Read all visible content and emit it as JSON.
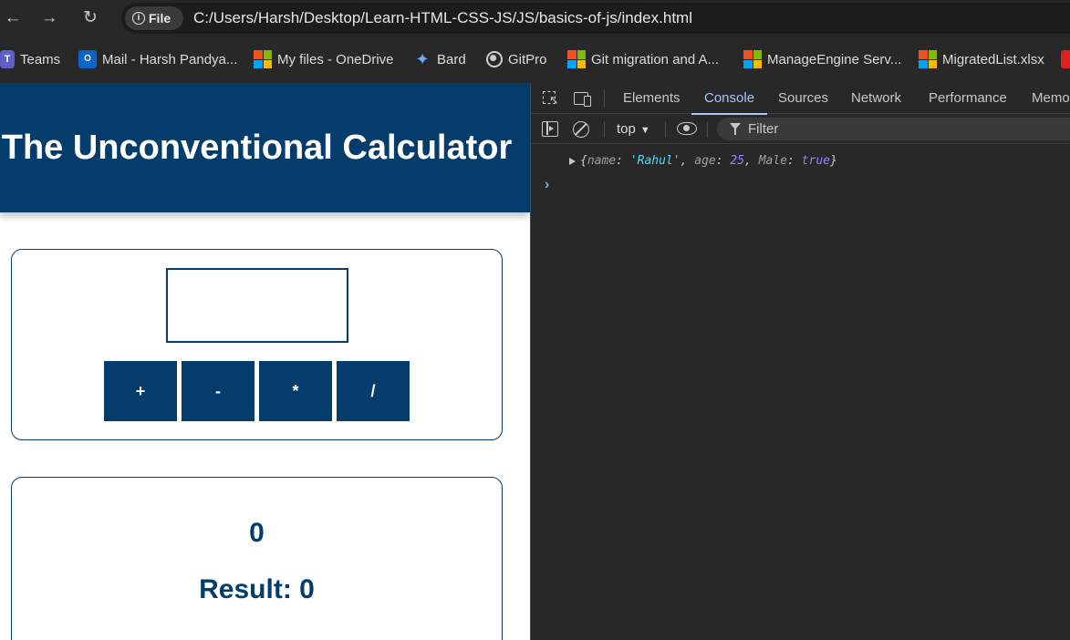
{
  "browser": {
    "file_chip": "File",
    "url": "C:/Users/Harsh/Desktop/Learn-HTML-CSS-JS/JS/basics-of-js/index.html"
  },
  "bookmarks": [
    {
      "label": "Teams"
    },
    {
      "label": "Mail - Harsh Pandya..."
    },
    {
      "label": "My files - OneDrive"
    },
    {
      "label": "Bard"
    },
    {
      "label": "GitPro"
    },
    {
      "label": "Git migration and A..."
    },
    {
      "label": "ManageEngine Serv..."
    },
    {
      "label": "MigratedList.xlsx"
    }
  ],
  "page": {
    "title": "The Unconventional Calculator",
    "input_value": "",
    "operators": [
      "+",
      "-",
      "*",
      "/"
    ],
    "current_number": "0",
    "result_text": "Result: 0"
  },
  "devtools": {
    "tabs": [
      "Elements",
      "Console",
      "Sources",
      "Network",
      "Performance",
      "Memo"
    ],
    "active_tab": "Console",
    "context": "top",
    "filter_placeholder": "Filter",
    "log": {
      "open": "{",
      "close": "}",
      "entries": [
        {
          "key": "name",
          "value": "'Rahul'",
          "type": "string"
        },
        {
          "key": "age",
          "value": "25",
          "type": "number"
        },
        {
          "key": "Male",
          "value": "true",
          "type": "boolean"
        }
      ]
    },
    "prompt": "›"
  },
  "colors": {
    "brand_navy": "#043c6c",
    "devtools_bg": "#282828",
    "active_tab": "#a8c7fa",
    "string_value": "#5cd5fb",
    "number_value": "#9980ff"
  }
}
